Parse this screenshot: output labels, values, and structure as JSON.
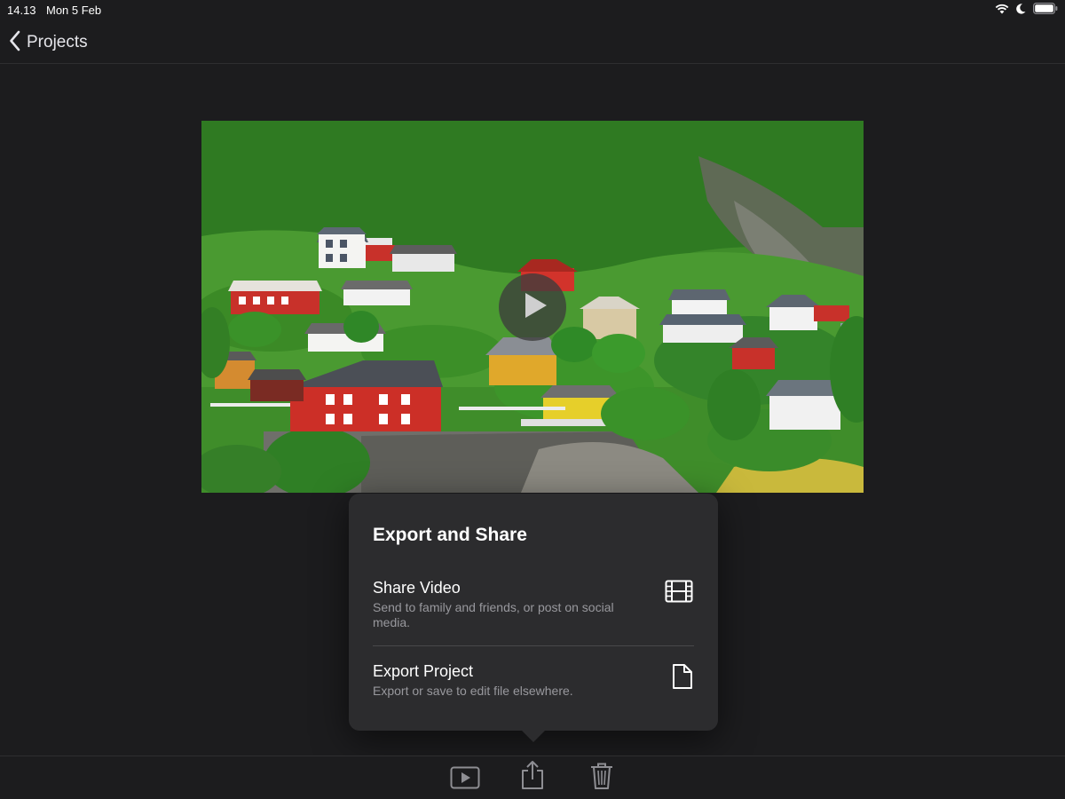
{
  "status_bar": {
    "time": "14.13",
    "date": "Mon 5 Feb",
    "icons": [
      "wifi-icon",
      "moon-icon",
      "battery-icon"
    ]
  },
  "nav": {
    "back_label": "Projects"
  },
  "video": {
    "play_icon": "play-icon"
  },
  "popover": {
    "title": "Export and Share",
    "items": [
      {
        "title": "Share Video",
        "description": "Send to family and friends, or post on social media.",
        "icon": "film-icon"
      },
      {
        "title": "Export Project",
        "description": "Export or save to edit file elsewhere.",
        "icon": "document-icon"
      }
    ]
  },
  "toolbar": {
    "buttons": [
      "play-icon",
      "share-icon",
      "trash-icon"
    ]
  },
  "colors": {
    "background": "#1c1c1e",
    "popover": "#2c2c2e",
    "secondary_text": "#98989d"
  }
}
